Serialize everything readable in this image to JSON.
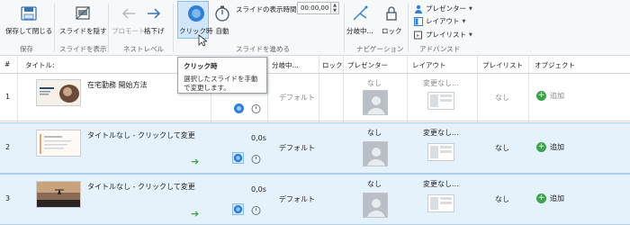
{
  "ribbon": {
    "groups": {
      "save": {
        "label": "保存",
        "button": "保存して閉じる"
      },
      "show_slides": {
        "label": "スライドを表示",
        "button": "スライドを隠す"
      },
      "next_level": {
        "label": "ネストレベル",
        "promote": "プロモート",
        "demote": "格下げ"
      },
      "advance": {
        "label": "スライドを進める",
        "on_click": "クリック時",
        "auto": "自動",
        "duration_label": "スライドの表示時間:",
        "duration_value": "00:00,00"
      },
      "navigation": {
        "label": "ナビゲーション",
        "branch": "分岐中...",
        "lock": "ロック"
      },
      "advanced": {
        "label": "アドバンスド",
        "presenter": "プレゼンター",
        "layout": "レイアウト",
        "playlist": "プレイリスト"
      }
    }
  },
  "tooltip": {
    "title": "クリック時",
    "body": "選択したスライドを手動で変更します。"
  },
  "table": {
    "headers": {
      "num": "#",
      "title": "タイトル:",
      "branch": "分岐中...",
      "lock": "ロック",
      "presenter": "プレゼンター",
      "layout": "レイアウト",
      "playlist": "プレイリスト",
      "object": "オブジェクト"
    },
    "rows": [
      {
        "num": "1",
        "title": "在宅勤務 開始方法",
        "duration": "",
        "branch": "デフォルト",
        "presenter": "なし",
        "layout": "変更なし...",
        "playlist": "なし",
        "object": "追加",
        "selected": false
      },
      {
        "num": "2",
        "title": "タイトルなし - クリックして変更",
        "duration": "0,0s",
        "branch": "デフォルト",
        "presenter": "なし",
        "layout": "変更なし...",
        "playlist": "なし",
        "object": "追加",
        "selected": true
      },
      {
        "num": "3",
        "title": "タイトルなし - クリックして変更",
        "duration": "0,0s",
        "branch": "デフォルト",
        "presenter": "なし",
        "layout": "変更なし...",
        "playlist": "なし",
        "object": "追加",
        "selected": true
      }
    ]
  },
  "colors": {
    "accent": "#1f7ad1",
    "selected_row": "#e5f1fb",
    "add_green": "#3fa34d"
  }
}
